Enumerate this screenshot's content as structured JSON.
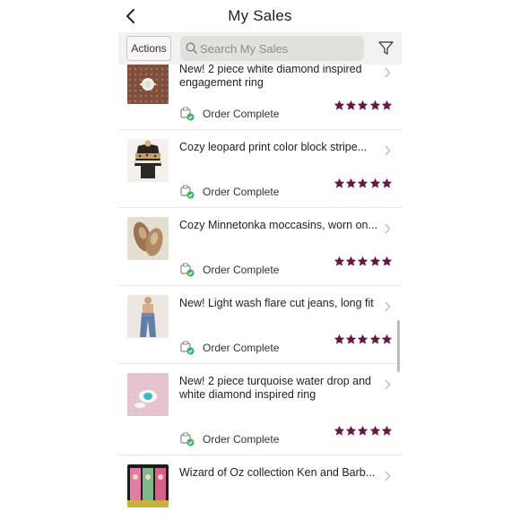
{
  "header": {
    "title": "My Sales"
  },
  "toolbar": {
    "actions_label": "Actions",
    "search_placeholder": "Search My Sales"
  },
  "colors": {
    "star": "#6b1446",
    "status_check": "#35b35a",
    "toolbar_bg": "#f3f2f0"
  },
  "sales": [
    {
      "title": "New! 2 piece white diamond inspired engagement ring",
      "status": "Order Complete",
      "rating": 5
    },
    {
      "title": "Cozy leopard print color block stripe...",
      "status": "Order Complete",
      "rating": 5
    },
    {
      "title": "Cozy Minnetonka moccasins, worn on...",
      "status": "Order Complete",
      "rating": 5
    },
    {
      "title": "New! Light wash flare cut jeans, long fit",
      "status": "Order Complete",
      "rating": 5
    },
    {
      "title": "New! 2 piece turquoise water drop and white diamond inspired ring",
      "status": "Order Complete",
      "rating": 5
    },
    {
      "title": "Wizard of Oz collection Ken and Barb..."
    }
  ]
}
